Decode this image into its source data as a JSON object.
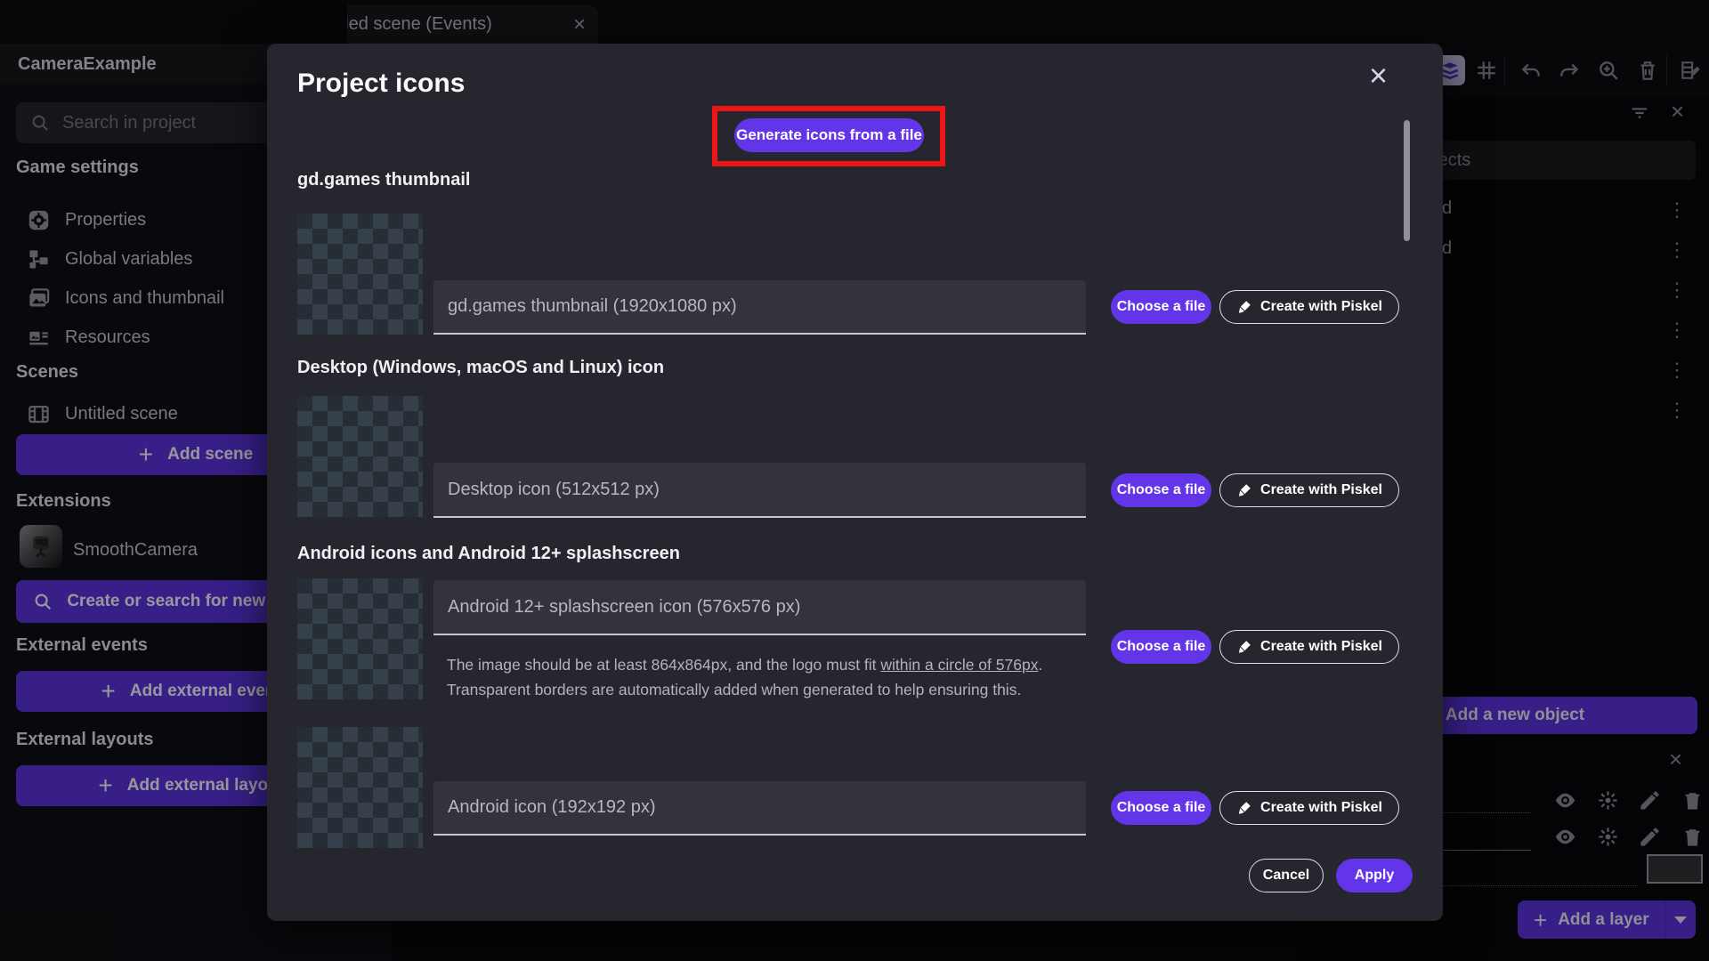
{
  "colors": {
    "accent_purple": "#6236e8",
    "modal_bg": "#26262e",
    "highlight_red": "#ee1515"
  },
  "topbar": {
    "tab_title": "Untitled scene (Events)",
    "tab_close_icon": "×"
  },
  "toolbar": {
    "icons": [
      "layers",
      "grid",
      "undo",
      "redo",
      "zoom-in",
      "trash",
      "edit-scene"
    ]
  },
  "project_panel": {
    "title": "CameraExample",
    "search_placeholder": "Search in project",
    "game_settings": {
      "label": "Game settings",
      "items": [
        {
          "icon": "properties-icon",
          "label": "Properties"
        },
        {
          "icon": "global-variables-icon",
          "label": "Global variables"
        },
        {
          "icon": "icons-thumbnail-icon",
          "label": "Icons and thumbnail"
        },
        {
          "icon": "resources-icon",
          "label": "Resources"
        }
      ]
    },
    "scenes": {
      "label": "Scenes",
      "items": [
        {
          "icon": "scene-icon",
          "label": "Untitled scene"
        }
      ],
      "add_button": "Add scene"
    },
    "extensions": {
      "label": "Extensions",
      "items": [
        {
          "icon": "extension-icon",
          "label": "SmoothCamera"
        }
      ],
      "search_button": "Create or search for new extensions"
    },
    "external_events": {
      "label": "External events",
      "add_button": "Add external events"
    },
    "external_layouts": {
      "label": "External layouts",
      "add_button": "Add external layouts"
    }
  },
  "objects_panel": {
    "search_placeholder": "Search objects",
    "row_fragments": [
      "d",
      "d",
      "",
      "",
      "",
      ""
    ],
    "kebab_icon": "⋮",
    "add_object_button": "Add a new object"
  },
  "layers_panel": {
    "add_layer_button": "Add a layer"
  },
  "modal": {
    "title": "Project icons",
    "close_icon": "×",
    "generate_button": "Generate icons from a file",
    "choose_file_label": "Choose a file",
    "piskel_label": "Create with Piskel",
    "sections": [
      {
        "heading": "gd.games thumbnail",
        "placeholder": "gd.games thumbnail (1920x1080 px)"
      },
      {
        "heading": "Desktop (Windows, macOS and Linux) icon",
        "placeholder": "Desktop icon (512x512 px)"
      },
      {
        "heading": "Android icons and Android 12+ splashscreen",
        "placeholder": "Android 12+ splashscreen icon (576x576 px)",
        "helper_pre": "The image should be at least 864x864px, and the logo must fit ",
        "helper_link": "within a circle of 576px",
        "helper_post": ".",
        "helper_line2": "Transparent borders are automatically added when generated to help ensuring this."
      },
      {
        "placeholder": "Android icon (192x192 px)"
      }
    ],
    "cancel_button": "Cancel",
    "apply_button": "Apply"
  }
}
